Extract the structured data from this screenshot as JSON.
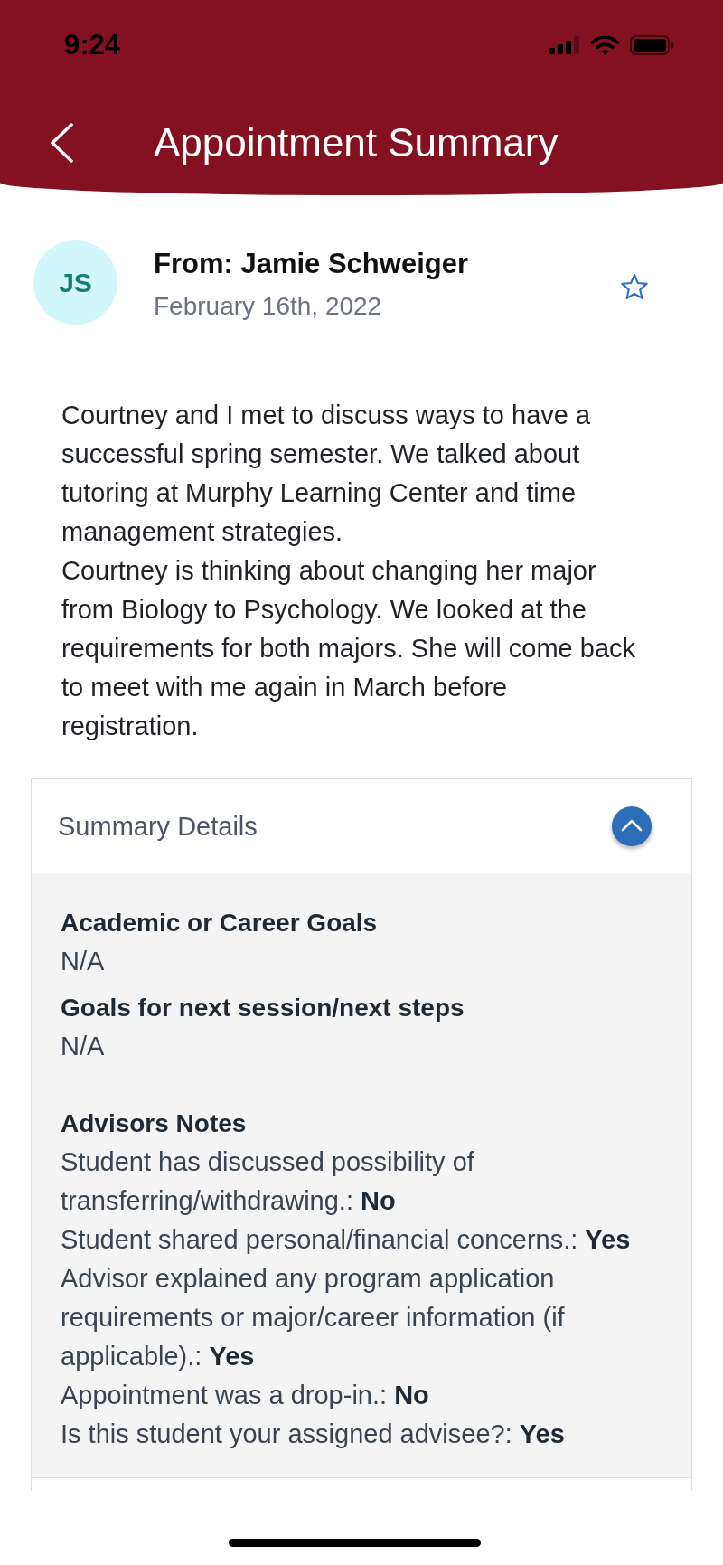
{
  "status_bar": {
    "time": "9:24"
  },
  "header": {
    "title": "Appointment Summary"
  },
  "note": {
    "initials": "JS",
    "from": "From: Jamie Schweiger",
    "date": "February 16th, 2022",
    "starred": false
  },
  "body": [
    "Courtney and I met to discuss ways to have a successful spring semester. We talked about tutoring at Murphy Learning Center and time management strategies.",
    "Courtney is thinking about changing her major from Biology to Psychology. We looked at the requirements for both majors. She will come back to meet with me again in March before registration."
  ],
  "summary_details": {
    "title": "Summary Details",
    "expanded": true,
    "fields": [
      {
        "label": "Academic or Career Goals",
        "value": "N/A"
      },
      {
        "label": "Goals for next session/next steps",
        "value": "N/A"
      }
    ],
    "notes": {
      "heading": "Advisors Notes",
      "lines": [
        "Student has discussed possibility of transferring/withdrawing.: **No**",
        "Student shared personal/financial concerns.: **Yes**",
        "Advisor explained any program application requirements or major/career information (if applicable).: **Yes**",
        "Appointment was a drop-in.: **No**",
        "Is this student your assigned advisee?: **Yes**"
      ]
    }
  }
}
